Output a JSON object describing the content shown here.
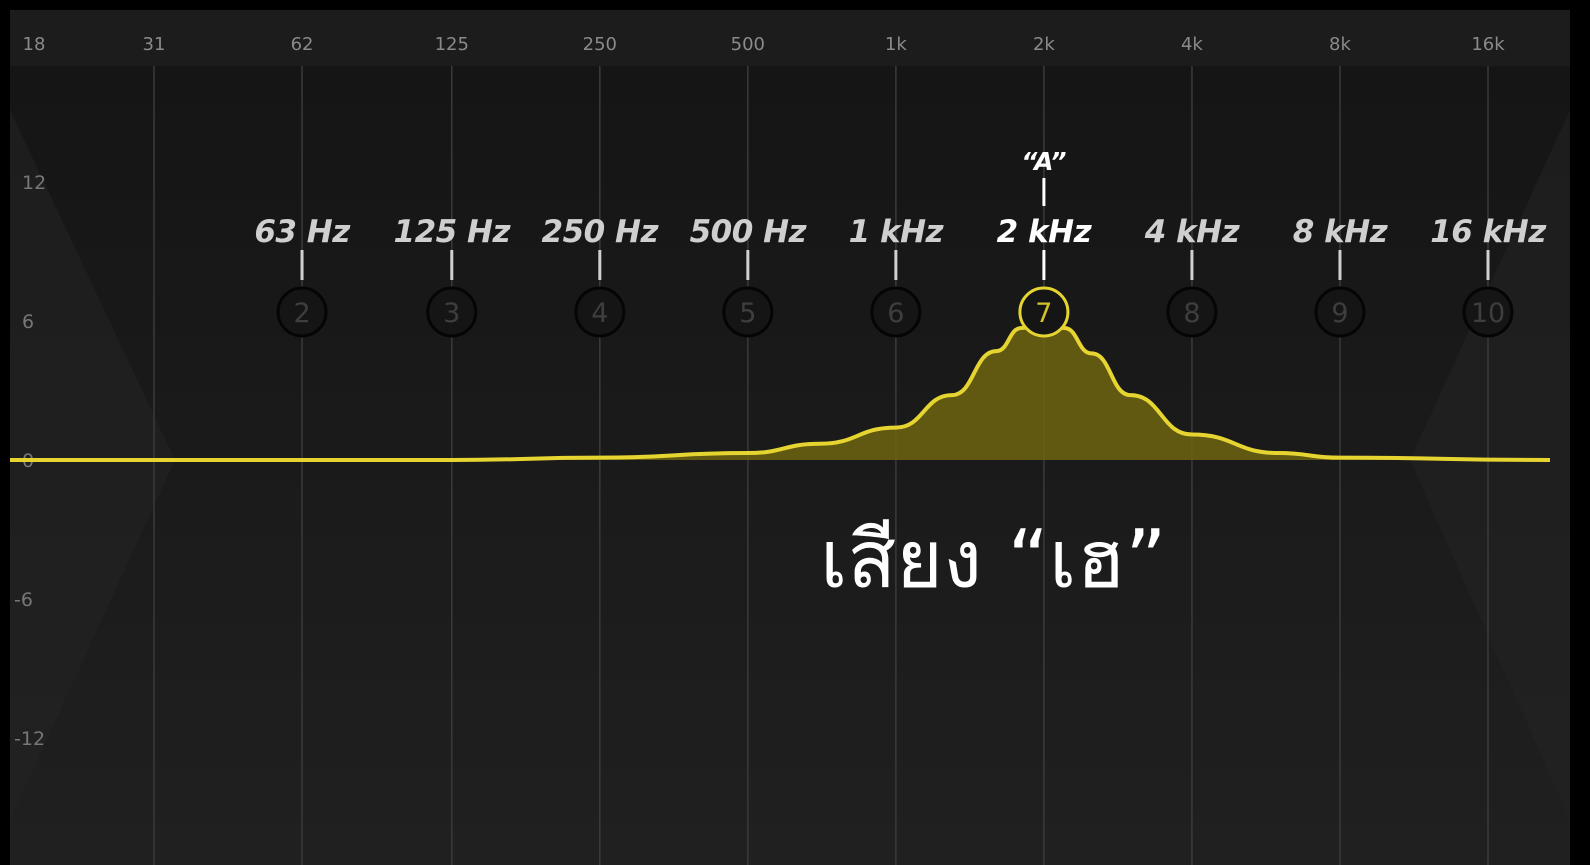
{
  "caption": "เสียง “เฮ”",
  "marker_label": "“A”",
  "active_band": 7,
  "colors": {
    "curve": "#e6d530",
    "fill": "#6f6410",
    "grid": "#3a3a3a",
    "background": "#191919",
    "header": "#1f1f1f"
  },
  "chart_data": {
    "type": "line",
    "title": "",
    "x_scale": "log",
    "xlim": [
      18,
      16000
    ],
    "ylim": [
      -15,
      18
    ],
    "grid": true,
    "freq_ticks": [
      {
        "label": "18",
        "hz": 18
      },
      {
        "label": "31",
        "hz": 31
      },
      {
        "label": "62",
        "hz": 62
      },
      {
        "label": "125",
        "hz": 125
      },
      {
        "label": "250",
        "hz": 250
      },
      {
        "label": "500",
        "hz": 500
      },
      {
        "label": "1k",
        "hz": 1000
      },
      {
        "label": "2k",
        "hz": 2000
      },
      {
        "label": "4k",
        "hz": 4000
      },
      {
        "label": "8k",
        "hz": 8000
      },
      {
        "label": "16k",
        "hz": 16000
      }
    ],
    "db_ticks": [
      {
        "label": "12",
        "db": 12
      },
      {
        "label": "6",
        "db": 6
      },
      {
        "label": "0",
        "db": 0
      },
      {
        "label": "-6",
        "db": -6
      },
      {
        "label": "-12",
        "db": -12
      }
    ],
    "bands": [
      {
        "num": 2,
        "freq_label": "63 Hz",
        "hz": 62
      },
      {
        "num": 3,
        "freq_label": "125 Hz",
        "hz": 125
      },
      {
        "num": 4,
        "freq_label": "250 Hz",
        "hz": 250
      },
      {
        "num": 5,
        "freq_label": "500 Hz",
        "hz": 500
      },
      {
        "num": 6,
        "freq_label": "1 kHz",
        "hz": 1000
      },
      {
        "num": 7,
        "freq_label": "2 kHz",
        "hz": 2000
      },
      {
        "num": 8,
        "freq_label": "4 kHz",
        "hz": 4000
      },
      {
        "num": 9,
        "freq_label": "8 kHz",
        "hz": 8000
      },
      {
        "num": 10,
        "freq_label": "16 kHz",
        "hz": 16000
      }
    ],
    "series": [
      {
        "x": [
          18,
          125,
          250,
          500,
          700,
          1000,
          1300,
          1600,
          1800,
          2000,
          2200,
          2500,
          3000,
          4000,
          6000,
          8000,
          16000
        ],
        "y": [
          0,
          0,
          0.1,
          0.3,
          0.7,
          1.4,
          2.8,
          4.7,
          5.7,
          6.0,
          5.7,
          4.6,
          2.8,
          1.1,
          0.3,
          0.1,
          0
        ]
      }
    ]
  }
}
